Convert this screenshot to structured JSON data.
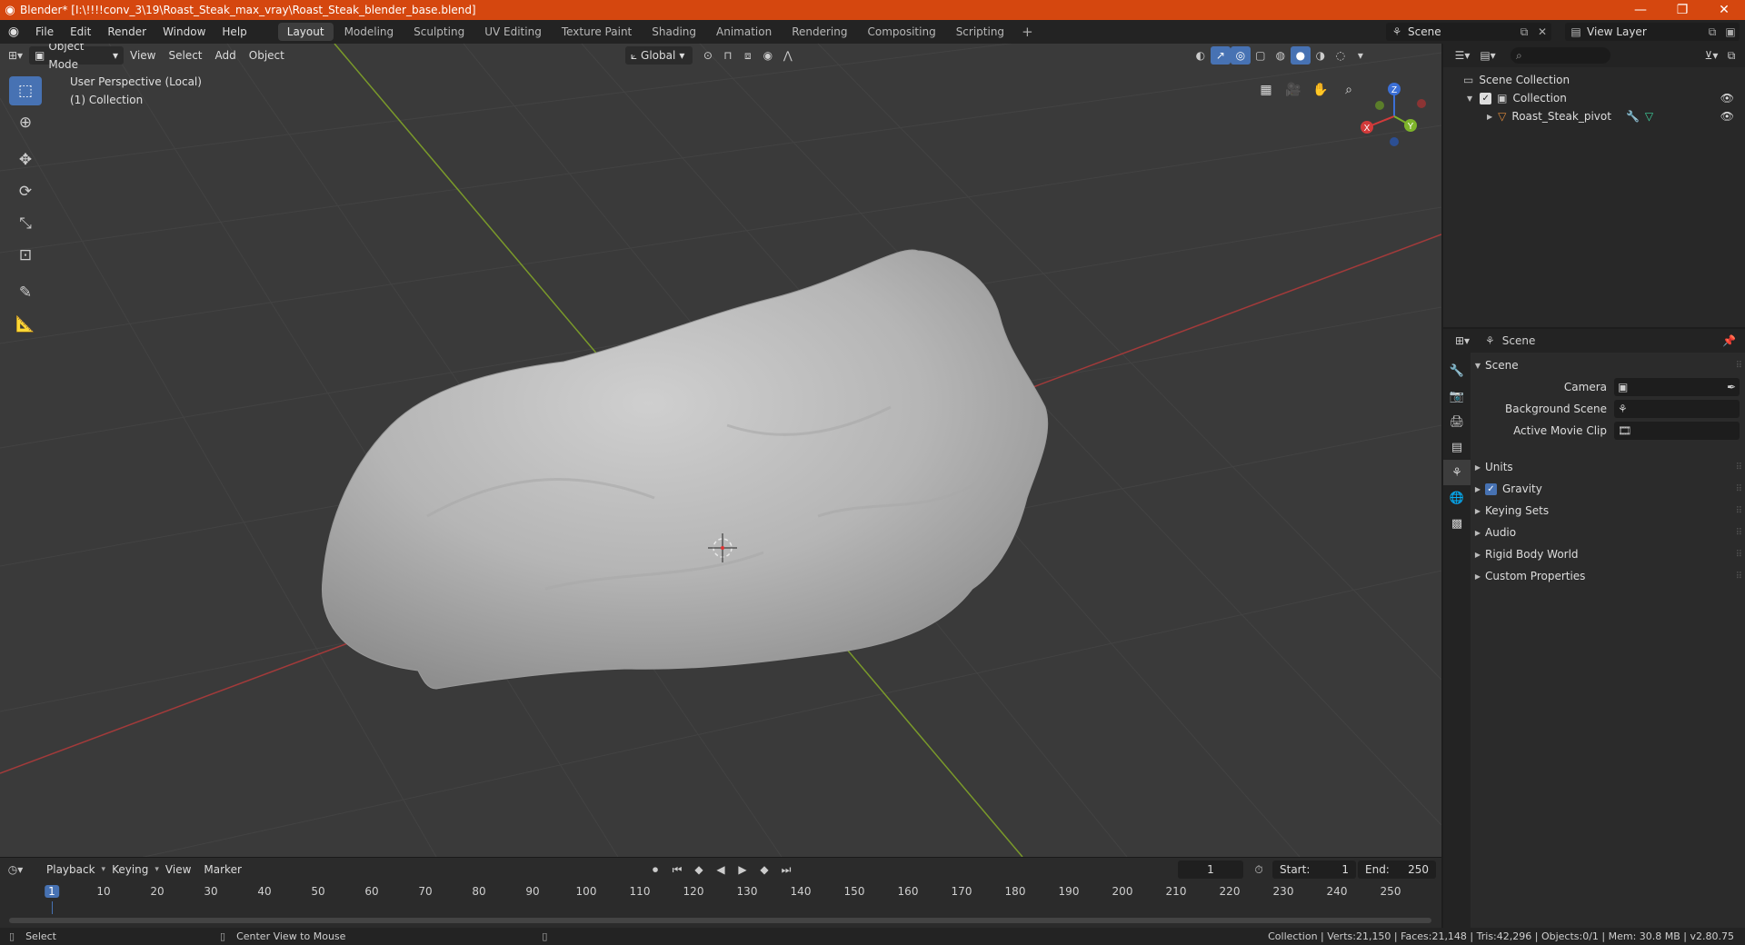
{
  "window": {
    "title": "Blender* [I:\\!!!!conv_3\\19\\Roast_Steak_max_vray\\Roast_Steak_blender_base.blend]",
    "minimize": "—",
    "maximize": "❐",
    "close": "✕"
  },
  "menus": [
    "File",
    "Edit",
    "Render",
    "Window",
    "Help"
  ],
  "workspaces": [
    "Layout",
    "Modeling",
    "Sculpting",
    "UV Editing",
    "Texture Paint",
    "Shading",
    "Animation",
    "Rendering",
    "Compositing",
    "Scripting"
  ],
  "workspace_active": "Layout",
  "scene_name": "Scene",
  "view_layer": "View Layer",
  "viewport": {
    "mode": "Object Mode",
    "menus": [
      "View",
      "Select",
      "Add",
      "Object"
    ],
    "orientation": "Global",
    "perspective": "User Perspective (Local)",
    "collection_info": "(1) Collection",
    "gizmo": {
      "x": "X",
      "y": "Y",
      "z": "Z"
    }
  },
  "toolbar": [
    "select-box",
    "cursor",
    "move",
    "rotate",
    "scale",
    "transform",
    "annotate",
    "measure"
  ],
  "timeline": {
    "menus": [
      "Playback",
      "Keying",
      "View",
      "Marker"
    ],
    "current_frame": "1",
    "start_label": "Start:",
    "start": "1",
    "end_label": "End:",
    "end": "250",
    "ticks": [
      "1",
      "10",
      "20",
      "30",
      "40",
      "50",
      "60",
      "70",
      "80",
      "90",
      "100",
      "110",
      "120",
      "130",
      "140",
      "150",
      "160",
      "170",
      "180",
      "190",
      "200",
      "210",
      "220",
      "230",
      "240",
      "250"
    ]
  },
  "statusbar": {
    "select": "Select",
    "center": "Center View to Mouse",
    "stats": "Collection | Verts:21,150 | Faces:21,148 | Tris:42,296 | Objects:0/1 | Mem: 30.8 MB | v2.80.75"
  },
  "outliner": {
    "root": "Scene Collection",
    "collection": "Collection",
    "object": "Roast_Steak_pivot"
  },
  "properties": {
    "context": "Scene",
    "panel_title": "Scene",
    "fields": {
      "camera": "Camera",
      "background_scene": "Background Scene",
      "active_movie_clip": "Active Movie Clip"
    },
    "subpanels": [
      "Units",
      "Gravity",
      "Keying Sets",
      "Audio",
      "Rigid Body World",
      "Custom Properties"
    ]
  },
  "colors": {
    "title_bar": "#d5470f",
    "accent": "#4772b3",
    "x_axis": "#a33a3a",
    "y_axis": "#7a9a2a",
    "object_orange": "#e08a3a"
  }
}
